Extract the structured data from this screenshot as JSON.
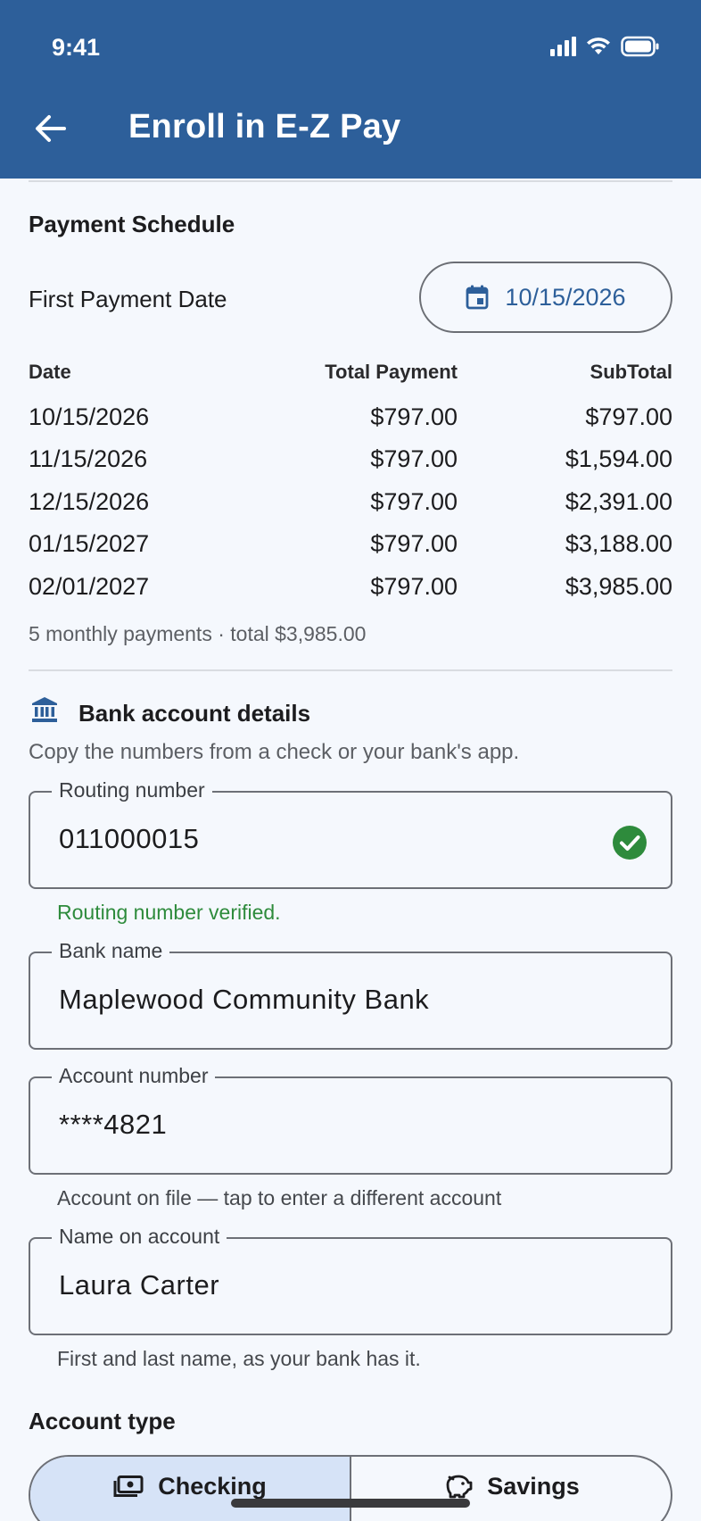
{
  "status_bar": {
    "time": "9:41"
  },
  "app_bar": {
    "title": "Enroll in E-Z Pay"
  },
  "schedule": {
    "title": "Payment Schedule",
    "first_payment_label": "First Payment Date",
    "first_payment_date": "10/15/2026",
    "headers": {
      "date": "Date",
      "total": "Total Payment",
      "subtotal": "SubTotal"
    },
    "rows": [
      {
        "date": "10/15/2026",
        "total": "$797.00",
        "subtotal": "$797.00"
      },
      {
        "date": "11/15/2026",
        "total": "$797.00",
        "subtotal": "$1,594.00"
      },
      {
        "date": "12/15/2026",
        "total": "$797.00",
        "subtotal": "$2,391.00"
      },
      {
        "date": "01/15/2027",
        "total": "$797.00",
        "subtotal": "$3,188.00"
      },
      {
        "date": "02/01/2027",
        "total": "$797.00",
        "subtotal": "$3,985.00"
      }
    ],
    "summary": "5 monthly payments · total $3,985.00"
  },
  "bank": {
    "title": "Bank account details",
    "subtitle": "Copy the numbers from a check or your bank's app.",
    "routing": {
      "label": "Routing number",
      "value": "011000015",
      "helper": "Routing number verified."
    },
    "bank_name": {
      "label": "Bank name",
      "value": "Maplewood Community Bank"
    },
    "account_number": {
      "label": "Account number",
      "value": "****4821",
      "helper": "Account on file — tap to enter a different account"
    },
    "name_on_account": {
      "label": "Name on account",
      "value": "Laura Carter",
      "helper": "First and last name, as your bank has it."
    }
  },
  "account_type": {
    "title": "Account type",
    "options": [
      {
        "label": "Checking",
        "selected": true
      },
      {
        "label": "Savings",
        "selected": false
      }
    ]
  },
  "colors": {
    "primary": "#2d5f9a",
    "success": "#2e8b3c",
    "selected_segment": "#d6e3f7"
  }
}
